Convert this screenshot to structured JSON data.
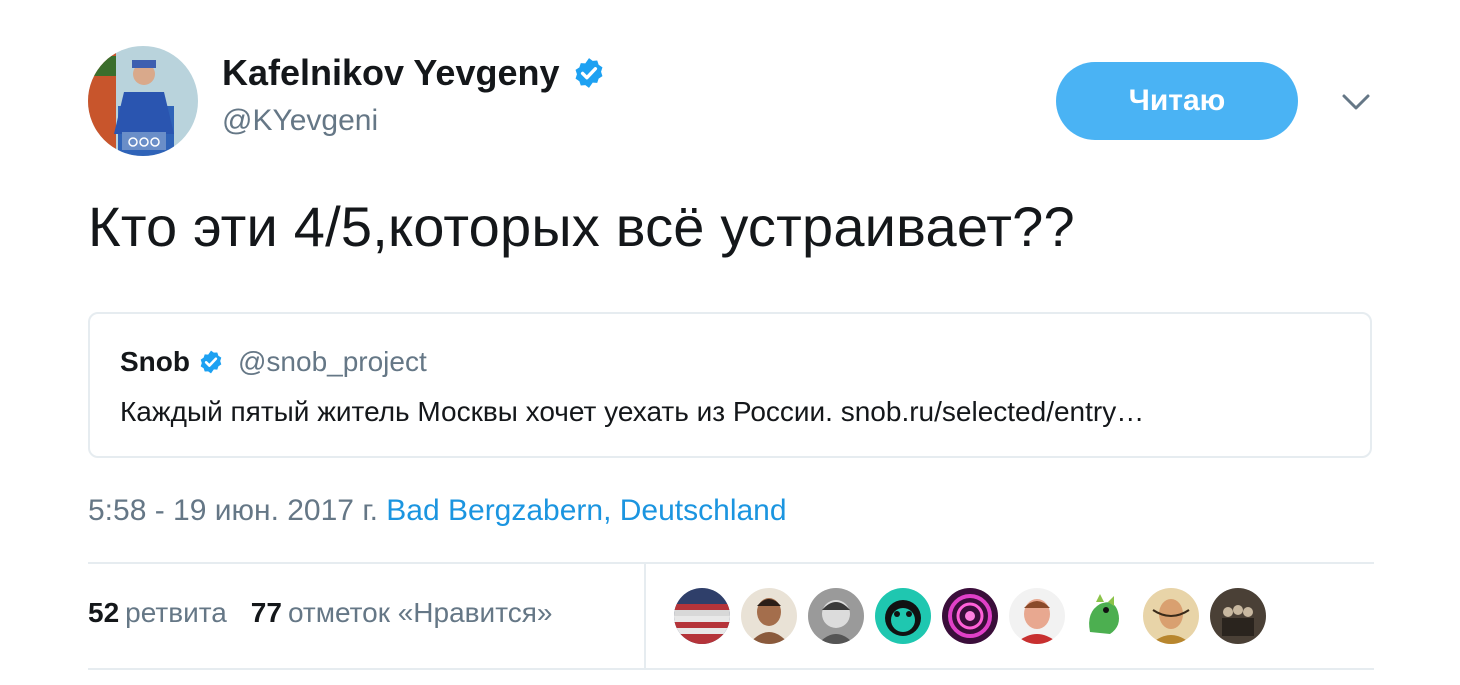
{
  "tweet": {
    "author_name": "Kafelnikov Yevgeny",
    "author_handle": "@KYevgeni",
    "follow_label": "Читаю",
    "text": "Кто эти 4/5,которых всё устраивает??",
    "quote": {
      "name": "Snob",
      "handle": "@snob_project",
      "text": "Каждый пятый житель Москвы хочет уехать из России. snob.ru/selected/entry…"
    },
    "time": "5:58 - 19 июн. 2017 г.",
    "location": "Bad Bergzabern, Deutschland",
    "retweets_count": "52",
    "retweets_label": "ретвита",
    "likes_count": "77",
    "likes_label": "отметок «Нравится»"
  },
  "icons": {
    "verified": "verified-badge-icon",
    "chevron": "chevron-down-icon"
  },
  "colors": {
    "accent": "#1b95e0",
    "follow_button": "#4ab3f4",
    "secondary_text": "#657786",
    "border": "#e6ecf0"
  }
}
